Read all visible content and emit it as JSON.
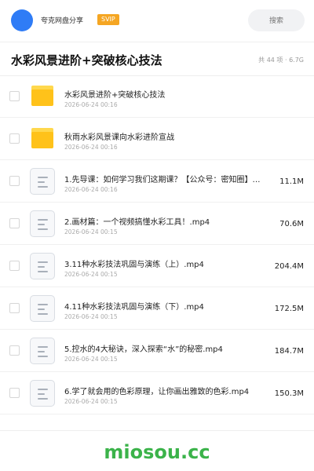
{
  "header": {
    "app_name": "夸克网盘分享",
    "badge": "SVIP",
    "search_placeholder": "搜索"
  },
  "title_bar": {
    "title": "水彩风景进阶+突破核心技法",
    "meta": "共 44 项 · 6.7G"
  },
  "files": [
    {
      "type": "folder",
      "name": "水彩风景进阶+突破核心技法",
      "date": "2026-06-24 00:16",
      "size": ""
    },
    {
      "type": "folder",
      "name": "秋雨水彩风景课向水彩进阶宣战",
      "date": "2026-06-24 00:16",
      "size": ""
    },
    {
      "type": "file",
      "name": "1.先导课：如何学习我们这期课？【公众号：密知圈】…",
      "date": "2026-06-24 00:16",
      "size": "11.1M"
    },
    {
      "type": "file",
      "name": "2.画材篇：一个视频搞懂水彩工具！.mp4",
      "date": "2026-06-24 00:15",
      "size": "70.6M"
    },
    {
      "type": "file",
      "name": "3.11种水彩技法巩固与演练（上）.mp4",
      "date": "2026-06-24 00:15",
      "size": "204.4M"
    },
    {
      "type": "file",
      "name": "4.11种水彩技法巩固与演练（下）.mp4",
      "date": "2026-06-24 00:15",
      "size": "172.5M"
    },
    {
      "type": "file",
      "name": "5.控水的4大秘诀，深入探索“水”的秘密.mp4",
      "date": "2026-06-24 00:15",
      "size": "184.7M"
    },
    {
      "type": "file",
      "name": "6.学了就会用的色彩原理，让你画出雅致的色彩.mp4",
      "date": "2026-06-24 00:15",
      "size": "150.3M"
    }
  ],
  "watermark": "miosou.cc",
  "colors": {
    "avatar": "#2f7cf6",
    "badge": "#f5a623",
    "folder": "#ffc21a",
    "watermark": "#3bb34a"
  }
}
